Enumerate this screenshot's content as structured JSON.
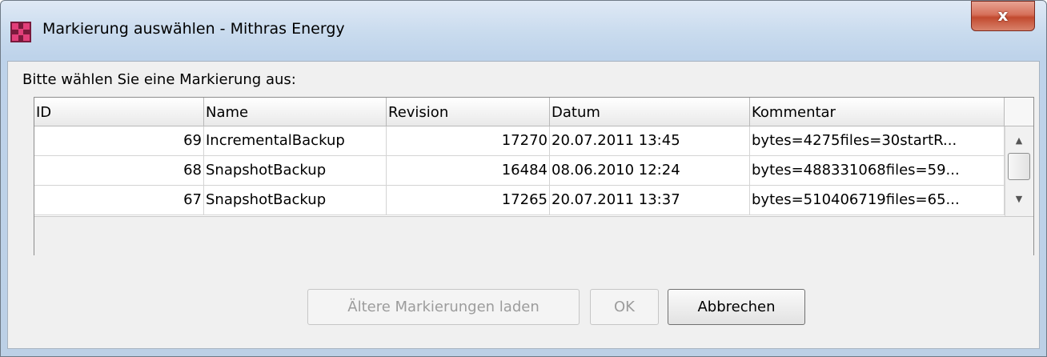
{
  "window": {
    "title": "Markierung auswählen - Mithras Energy",
    "close_label": "x",
    "app_icon": "firstspirit-app-icon"
  },
  "dialog": {
    "prompt": "Bitte wählen Sie eine Markierung aus:"
  },
  "table": {
    "columns": [
      "ID",
      "Name",
      "Revision",
      "Datum",
      "Kommentar"
    ],
    "rows": [
      {
        "id": "69",
        "name": "IncrementalBackup",
        "revision": "17270",
        "datum": "20.07.2011 13:45",
        "kommentar": "bytes=4275files=30startR..."
      },
      {
        "id": "68",
        "name": "SnapshotBackup",
        "revision": "16484",
        "datum": "08.06.2010 12:24",
        "kommentar": "bytes=488331068files=59..."
      },
      {
        "id": "67",
        "name": "SnapshotBackup",
        "revision": "17265",
        "datum": "20.07.2011 13:37",
        "kommentar": "bytes=510406719files=65..."
      }
    ],
    "scroll_up_icon": "up-arrow-icon",
    "scroll_down_icon": "down-arrow-icon"
  },
  "buttons": {
    "load_older": "Ältere Markierungen laden",
    "ok": "OK",
    "cancel": "Abbrechen"
  },
  "colors": {
    "close_button": "#c24a2f",
    "app_icon_dark": "#7a1a3c",
    "app_icon_light": "#e23f7a"
  }
}
